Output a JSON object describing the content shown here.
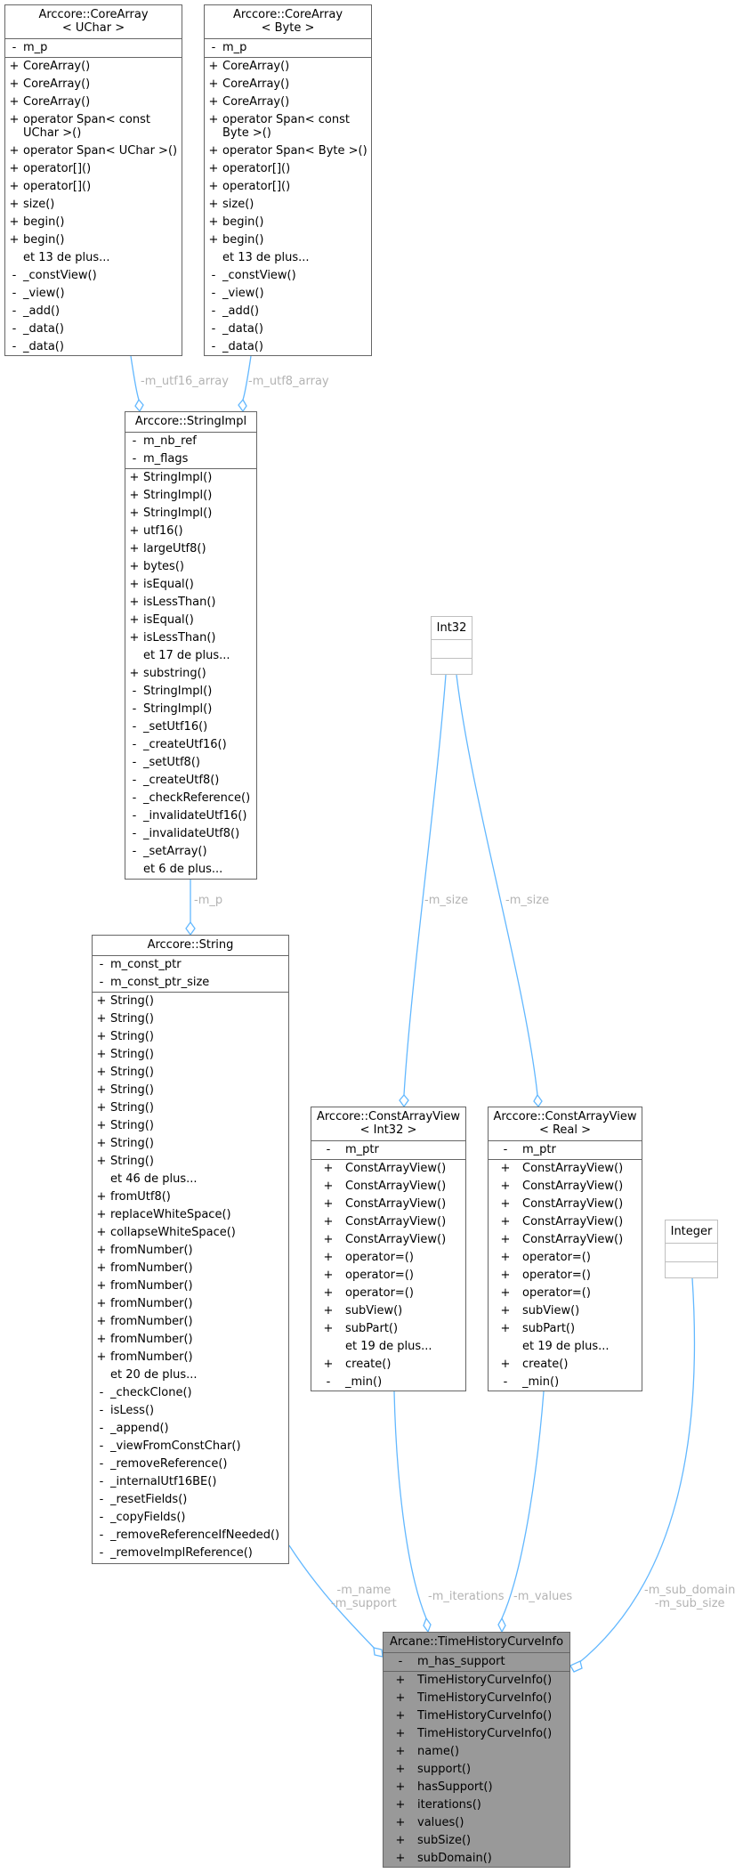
{
  "classes": {
    "corearray_uchar": {
      "title": "Arccore::CoreArray\n< UChar >",
      "attributes": [
        {
          "vis": "-",
          "name": "m_p"
        }
      ],
      "methods": [
        {
          "vis": "+",
          "name": "CoreArray()"
        },
        {
          "vis": "+",
          "name": "CoreArray()"
        },
        {
          "vis": "+",
          "name": "CoreArray()"
        },
        {
          "vis": "+",
          "name": "operator Span< const UChar >()"
        },
        {
          "vis": "+",
          "name": "operator Span< UChar >()"
        },
        {
          "vis": "+",
          "name": "operator[]()"
        },
        {
          "vis": "+",
          "name": "operator[]()"
        },
        {
          "vis": "+",
          "name": "size()"
        },
        {
          "vis": "+",
          "name": "begin()"
        },
        {
          "vis": "+",
          "name": "begin()"
        },
        {
          "vis": "",
          "name": "et 13 de plus..."
        },
        {
          "vis": "-",
          "name": "_constView()"
        },
        {
          "vis": "-",
          "name": "_view()"
        },
        {
          "vis": "-",
          "name": "_add()"
        },
        {
          "vis": "-",
          "name": "_data()"
        },
        {
          "vis": "-",
          "name": "_data()"
        }
      ]
    },
    "corearray_byte": {
      "title": "Arccore::CoreArray\n< Byte >",
      "attributes": [
        {
          "vis": "-",
          "name": "m_p"
        }
      ],
      "methods": [
        {
          "vis": "+",
          "name": "CoreArray()"
        },
        {
          "vis": "+",
          "name": "CoreArray()"
        },
        {
          "vis": "+",
          "name": "CoreArray()"
        },
        {
          "vis": "+",
          "name": "operator Span< const Byte >()"
        },
        {
          "vis": "+",
          "name": "operator Span< Byte >()"
        },
        {
          "vis": "+",
          "name": "operator[]()"
        },
        {
          "vis": "+",
          "name": "operator[]()"
        },
        {
          "vis": "+",
          "name": "size()"
        },
        {
          "vis": "+",
          "name": "begin()"
        },
        {
          "vis": "+",
          "name": "begin()"
        },
        {
          "vis": "",
          "name": "et 13 de plus..."
        },
        {
          "vis": "-",
          "name": "_constView()"
        },
        {
          "vis": "-",
          "name": "_view()"
        },
        {
          "vis": "-",
          "name": "_add()"
        },
        {
          "vis": "-",
          "name": "_data()"
        },
        {
          "vis": "-",
          "name": "_data()"
        }
      ]
    },
    "stringimpl": {
      "title": "Arccore::StringImpl",
      "attributes": [
        {
          "vis": "-",
          "name": "m_nb_ref"
        },
        {
          "vis": "-",
          "name": "m_flags"
        }
      ],
      "methods": [
        {
          "vis": "+",
          "name": "StringImpl()"
        },
        {
          "vis": "+",
          "name": "StringImpl()"
        },
        {
          "vis": "+",
          "name": "StringImpl()"
        },
        {
          "vis": "+",
          "name": "utf16()"
        },
        {
          "vis": "+",
          "name": "largeUtf8()"
        },
        {
          "vis": "+",
          "name": "bytes()"
        },
        {
          "vis": "+",
          "name": "isEqual()"
        },
        {
          "vis": "+",
          "name": "isLessThan()"
        },
        {
          "vis": "+",
          "name": "isEqual()"
        },
        {
          "vis": "+",
          "name": "isLessThan()"
        },
        {
          "vis": "",
          "name": "et 17 de plus..."
        },
        {
          "vis": "+",
          "name": "substring()"
        },
        {
          "vis": "-",
          "name": "StringImpl()"
        },
        {
          "vis": "-",
          "name": "StringImpl()"
        },
        {
          "vis": "-",
          "name": "_setUtf16()"
        },
        {
          "vis": "-",
          "name": "_createUtf16()"
        },
        {
          "vis": "-",
          "name": "_setUtf8()"
        },
        {
          "vis": "-",
          "name": "_createUtf8()"
        },
        {
          "vis": "-",
          "name": "_checkReference()"
        },
        {
          "vis": "-",
          "name": "_invalidateUtf16()"
        },
        {
          "vis": "-",
          "name": "_invalidateUtf8()"
        },
        {
          "vis": "-",
          "name": "_setArray()"
        },
        {
          "vis": "",
          "name": "et 6 de plus..."
        }
      ]
    },
    "string": {
      "title": "Arccore::String",
      "attributes": [
        {
          "vis": "-",
          "name": "m_const_ptr"
        },
        {
          "vis": "-",
          "name": "m_const_ptr_size"
        }
      ],
      "methods": [
        {
          "vis": "+",
          "name": "String()"
        },
        {
          "vis": "+",
          "name": "String()"
        },
        {
          "vis": "+",
          "name": "String()"
        },
        {
          "vis": "+",
          "name": "String()"
        },
        {
          "vis": "+",
          "name": "String()"
        },
        {
          "vis": "+",
          "name": "String()"
        },
        {
          "vis": "+",
          "name": "String()"
        },
        {
          "vis": "+",
          "name": "String()"
        },
        {
          "vis": "+",
          "name": "String()"
        },
        {
          "vis": "+",
          "name": "String()"
        },
        {
          "vis": "",
          "name": "et 46 de plus..."
        },
        {
          "vis": "+",
          "name": "fromUtf8()"
        },
        {
          "vis": "+",
          "name": "replaceWhiteSpace()"
        },
        {
          "vis": "+",
          "name": "collapseWhiteSpace()"
        },
        {
          "vis": "+",
          "name": "fromNumber()"
        },
        {
          "vis": "+",
          "name": "fromNumber()"
        },
        {
          "vis": "+",
          "name": "fromNumber()"
        },
        {
          "vis": "+",
          "name": "fromNumber()"
        },
        {
          "vis": "+",
          "name": "fromNumber()"
        },
        {
          "vis": "+",
          "name": "fromNumber()"
        },
        {
          "vis": "+",
          "name": "fromNumber()"
        },
        {
          "vis": "",
          "name": "et 20 de plus..."
        },
        {
          "vis": "-",
          "name": "_checkClone()"
        },
        {
          "vis": "-",
          "name": "isLess()"
        },
        {
          "vis": "-",
          "name": "_append()"
        },
        {
          "vis": "-",
          "name": "_viewFromConstChar()"
        },
        {
          "vis": "-",
          "name": "_removeReference()"
        },
        {
          "vis": "-",
          "name": "_internalUtf16BE()"
        },
        {
          "vis": "-",
          "name": "_resetFields()"
        },
        {
          "vis": "-",
          "name": "_copyFields()"
        },
        {
          "vis": "-",
          "name": "_removeReferenceIfNeeded()"
        },
        {
          "vis": "-",
          "name": "_removeImplReference()"
        }
      ]
    },
    "int32": {
      "title": "Int32"
    },
    "integer": {
      "title": "Integer"
    },
    "cav_int32": {
      "title": "Arccore::ConstArrayView\n< Int32 >",
      "attributes": [
        {
          "vis": "-",
          "name": "m_ptr"
        }
      ],
      "methods": [
        {
          "vis": "+",
          "name": "ConstArrayView()"
        },
        {
          "vis": "+",
          "name": "ConstArrayView()"
        },
        {
          "vis": "+",
          "name": "ConstArrayView()"
        },
        {
          "vis": "+",
          "name": "ConstArrayView()"
        },
        {
          "vis": "+",
          "name": "ConstArrayView()"
        },
        {
          "vis": "+",
          "name": "operator=()"
        },
        {
          "vis": "+",
          "name": "operator=()"
        },
        {
          "vis": "+",
          "name": "operator=()"
        },
        {
          "vis": "+",
          "name": "subView()"
        },
        {
          "vis": "+",
          "name": "subPart()"
        },
        {
          "vis": "",
          "name": "et 19 de plus..."
        },
        {
          "vis": "+",
          "name": "create()"
        },
        {
          "vis": "-",
          "name": "_min()"
        }
      ]
    },
    "cav_real": {
      "title": "Arccore::ConstArrayView\n< Real >",
      "attributes": [
        {
          "vis": "-",
          "name": "m_ptr"
        }
      ],
      "methods": [
        {
          "vis": "+",
          "name": "ConstArrayView()"
        },
        {
          "vis": "+",
          "name": "ConstArrayView()"
        },
        {
          "vis": "+",
          "name": "ConstArrayView()"
        },
        {
          "vis": "+",
          "name": "ConstArrayView()"
        },
        {
          "vis": "+",
          "name": "ConstArrayView()"
        },
        {
          "vis": "+",
          "name": "operator=()"
        },
        {
          "vis": "+",
          "name": "operator=()"
        },
        {
          "vis": "+",
          "name": "operator=()"
        },
        {
          "vis": "+",
          "name": "subView()"
        },
        {
          "vis": "+",
          "name": "subPart()"
        },
        {
          "vis": "",
          "name": "et 19 de plus..."
        },
        {
          "vis": "+",
          "name": "create()"
        },
        {
          "vis": "-",
          "name": "_min()"
        }
      ]
    },
    "timehistory": {
      "title": "Arcane::TimeHistoryCurveInfo",
      "attributes": [
        {
          "vis": "-",
          "name": "m_has_support"
        }
      ],
      "methods": [
        {
          "vis": "+",
          "name": "TimeHistoryCurveInfo()"
        },
        {
          "vis": "+",
          "name": "TimeHistoryCurveInfo()"
        },
        {
          "vis": "+",
          "name": "TimeHistoryCurveInfo()"
        },
        {
          "vis": "+",
          "name": "TimeHistoryCurveInfo()"
        },
        {
          "vis": "+",
          "name": "name()"
        },
        {
          "vis": "+",
          "name": "support()"
        },
        {
          "vis": "+",
          "name": "hasSupport()"
        },
        {
          "vis": "+",
          "name": "iterations()"
        },
        {
          "vis": "+",
          "name": "values()"
        },
        {
          "vis": "+",
          "name": "subSize()"
        },
        {
          "vis": "+",
          "name": "subDomain()"
        }
      ]
    }
  },
  "edge_labels": {
    "utf16": "-m_utf16_array",
    "utf8": "-m_utf8_array",
    "m_p": "-m_p",
    "size_int32": "-m_size",
    "size_real": "-m_size",
    "name_support": "-m_name\n-m_support",
    "iterations": "-m_iterations",
    "values": "-m_values",
    "sub": "-m_sub_domain\n-m_sub_size"
  },
  "colors": {
    "edge": "#63b8ff",
    "label": "#b3b3b3",
    "border": "#666666",
    "highlight_fill": "#999999"
  }
}
